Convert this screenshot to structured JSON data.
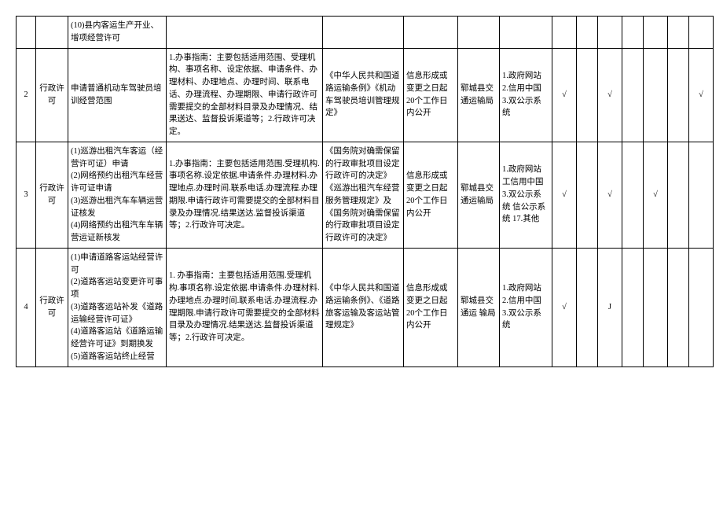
{
  "rows": [
    {
      "num": "",
      "type": "",
      "item": "(10)县内客运生产开业、增项经营许可",
      "guide": "",
      "basis": "",
      "time": "",
      "org": "",
      "platform": "",
      "chk": [
        "",
        "",
        "",
        "",
        "",
        "",
        ""
      ]
    },
    {
      "num": "2",
      "type": "行政许可",
      "item": "申请普通机动车驾驶员培训经营范围",
      "guide": "1.办事指南：主要包括适用范围、受理机构、事项名称、设定依据、申请条件、办理材料、办理地点、办理时间、联系电话、办理流程、办理期限、申请行政许可需要提交的全部材料目录及办理情况、结果送达、监督投诉渠道等；2.行政许可决定。",
      "basis": "《中华人民共和国道路运输条例》《机动车驾驶员培训管理规定》",
      "time": "信息形成或变更之日起20个工作日内公开",
      "org": "郓城县交通运输局",
      "platform": "1.政府网站 2.信用中国 3.双公示系统",
      "chk": [
        "√",
        "",
        "√",
        "",
        "",
        "",
        "√"
      ]
    },
    {
      "num": "3",
      "type": "行政许可",
      "item": "(1)巡游出租汽车客运（经营许可证）申请\n(2)网络预约出租汽车经营许可证申请\n(3)巡游出租汽车车辆运营证核发\n(4)网络预约出租汽车车辆营运证新核发",
      "guide": "1.办事指南：主要包括适用范围.受理机构.事项名称.设定依据.申请条件.办理材料.办理地点.办理时间.联系电话.办理流程.办理期限.申请行政许可需要提交的全部材料目录及办理情况.结果送达.监督投诉渠道等；2.行政许可决定。",
      "basis": "《国务院对确需保留的行政审批项目设定行政许可的决定》《巡游出租汽车经营服务管理规定》及《国务院对确需保留的行政审批项目设定行政许可的决定》",
      "time": "信息形成或变更之日起20个工作日内公开",
      "org": "郓城县交通运输局",
      "platform": "1.政府网站工信用中国 3.双公示系统 信公示系统 17.其他",
      "chk": [
        "√",
        "",
        "√",
        "",
        "√",
        "",
        ""
      ]
    },
    {
      "num": "4",
      "type": "行政许可",
      "item": "(1)申请道路客运站经营许可\n(2)道路客运站变更许可事项\n(3)道路客运站补发《道路运输经营许可证》\n(4)道路客运站《道路运输经营许可证》到期换发\n(5)道路客运站终止经营",
      "guide": "1. 办事指南：主要包括适用范围.受理机构.事项名称.设定依据.申请条件.办理材料.办理地点.办理时间.联系电话.办理流程.办理期限.申请行政许可需要提交的全部材料目录及办理情况.结果送达.监督投诉渠道等；2.行政许可决定。",
      "basis": "《中华人民共和国道路运输条例》、《道路旅客运输及客运站管理规定》",
      "time": "信息形成或变更之日起20个工作日内公开",
      "org": "郓城县交通运 输局",
      "platform": "1.政府网站 2.信用中国 3.双公示系统",
      "chk": [
        "√",
        "",
        "J",
        "",
        "",
        "",
        ""
      ]
    }
  ]
}
